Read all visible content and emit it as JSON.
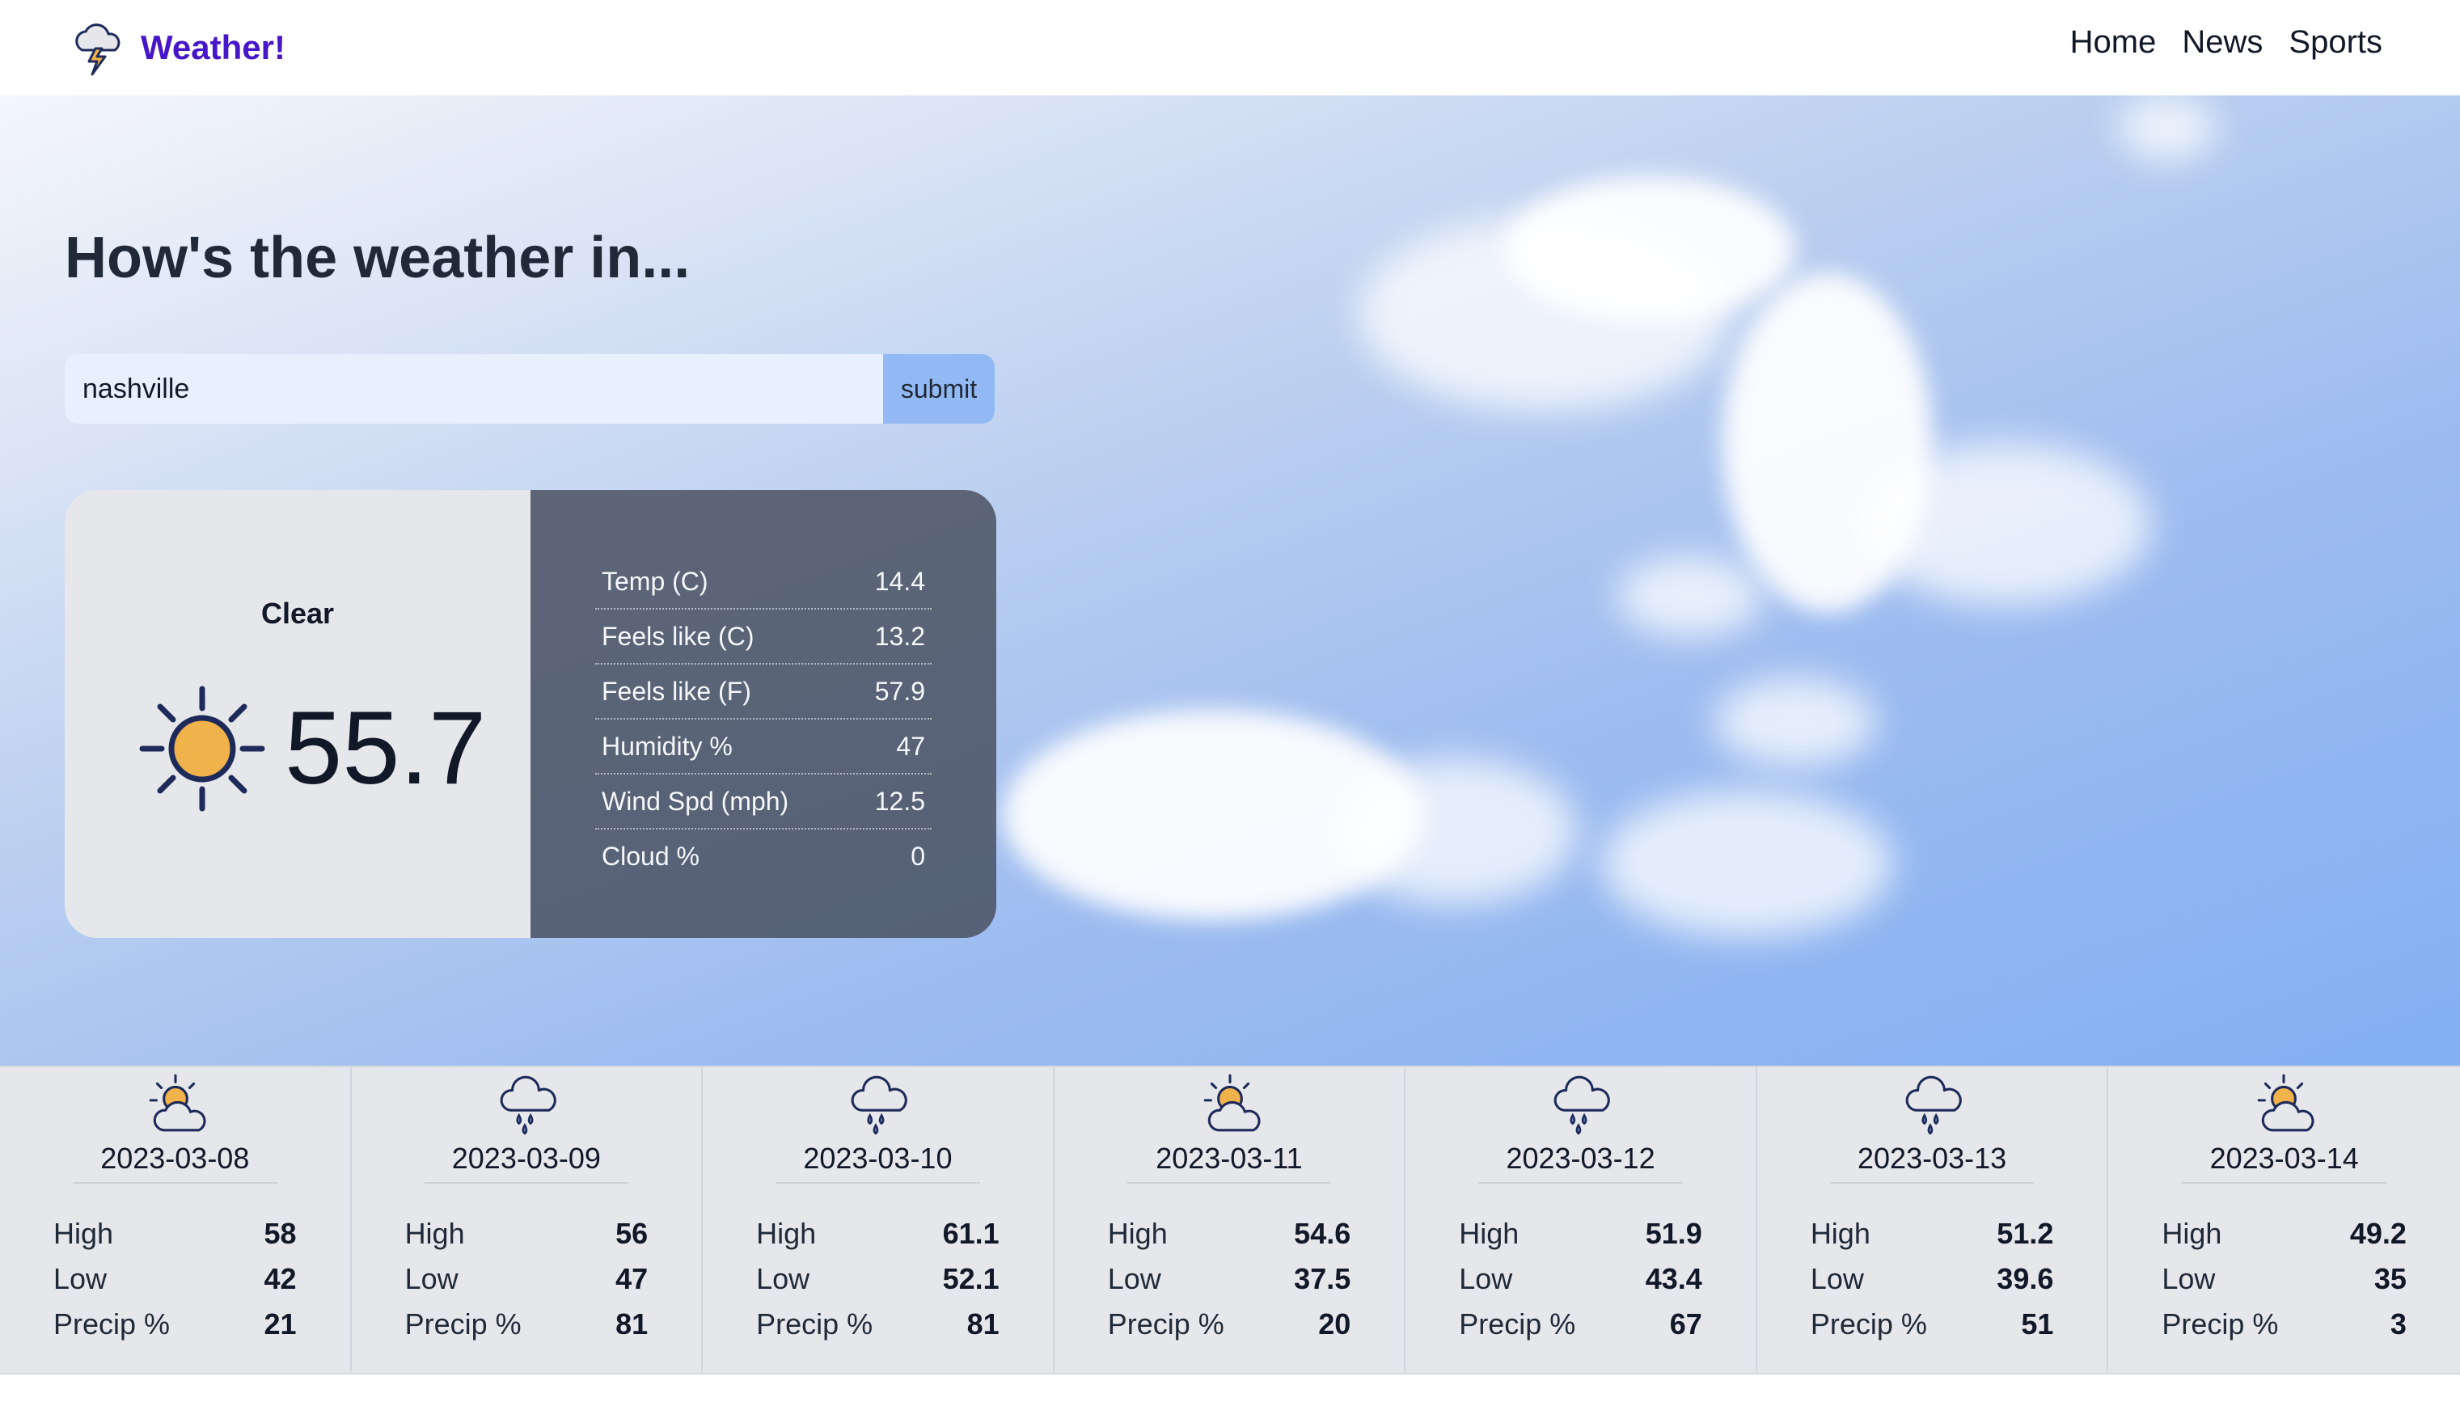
{
  "header": {
    "brand_name": "Weather!",
    "brand_icon": "storm-cloud-icon",
    "nav": [
      {
        "label": "Home"
      },
      {
        "label": "News"
      },
      {
        "label": "Sports"
      }
    ]
  },
  "hero": {
    "headline": "How's the weather in...",
    "search": {
      "value": "nashville",
      "button_label": "submit"
    }
  },
  "current": {
    "condition": "Clear",
    "icon": "sun-icon",
    "temperature": "55.7",
    "stats": [
      {
        "label": "Temp (C)",
        "value": "14.4"
      },
      {
        "label": "Feels like (C)",
        "value": "13.2"
      },
      {
        "label": "Feels like (F)",
        "value": "57.9"
      },
      {
        "label": "Humidity %",
        "value": "47"
      },
      {
        "label": "Wind Spd (mph)",
        "value": "12.5"
      },
      {
        "label": "Cloud %",
        "value": "0"
      }
    ]
  },
  "forecast": {
    "row_labels": {
      "high": "High",
      "low": "Low",
      "precip": "Precip %"
    },
    "days": [
      {
        "date": "2023-03-08",
        "icon": "partly-cloudy-icon",
        "high": "58",
        "low": "42",
        "precip": "21"
      },
      {
        "date": "2023-03-09",
        "icon": "rain-cloud-icon",
        "high": "56",
        "low": "47",
        "precip": "81"
      },
      {
        "date": "2023-03-10",
        "icon": "rain-cloud-icon",
        "high": "61.1",
        "low": "52.1",
        "precip": "81"
      },
      {
        "date": "2023-03-11",
        "icon": "partly-cloudy-icon",
        "high": "54.6",
        "low": "37.5",
        "precip": "20"
      },
      {
        "date": "2023-03-12",
        "icon": "rain-cloud-icon",
        "high": "51.9",
        "low": "43.4",
        "precip": "67"
      },
      {
        "date": "2023-03-13",
        "icon": "rain-cloud-icon",
        "high": "51.2",
        "low": "39.6",
        "precip": "51"
      },
      {
        "date": "2023-03-14",
        "icon": "partly-cloudy-icon",
        "high": "49.2",
        "low": "35",
        "precip": "3"
      }
    ]
  },
  "colors": {
    "brand": "#4716c9",
    "submit": "#93b9f4",
    "input_bg": "#e8f0fe",
    "sun": "#f0b24a",
    "icon_stroke": "#1e2a5a"
  }
}
